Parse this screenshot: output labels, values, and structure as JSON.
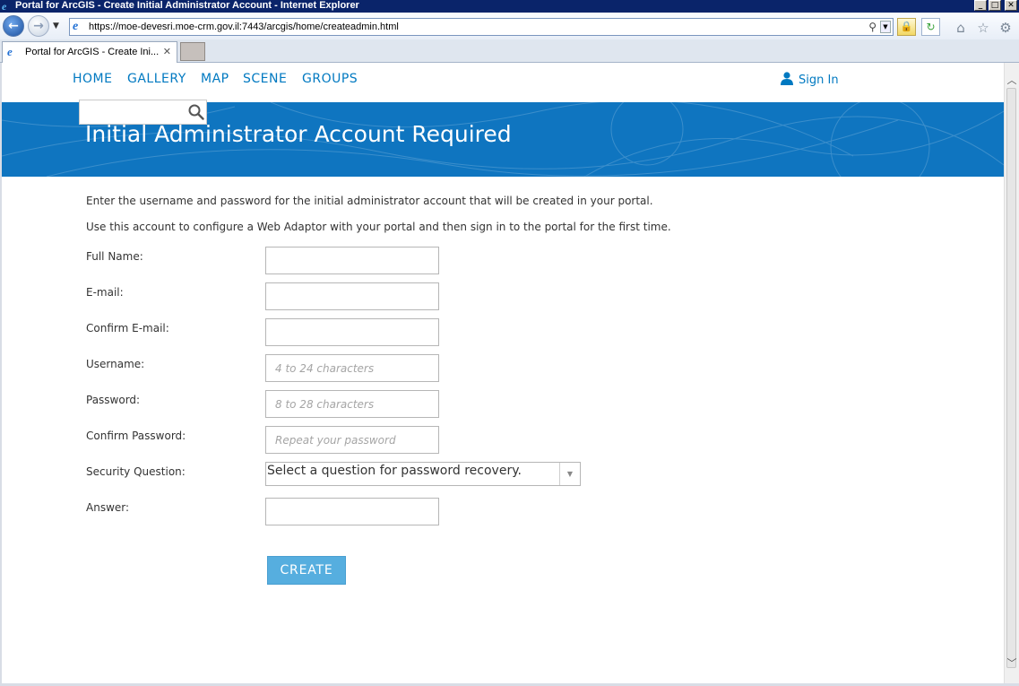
{
  "window": {
    "title": "Portal for ArcGIS - Create Initial Administrator Account - Internet Explorer",
    "minimize": "_",
    "maximize": "□",
    "close": "✕"
  },
  "browser": {
    "url": "https://moe-devesri.moe-crm.gov.il:7443/arcgis/home/createadmin.html",
    "tab_title": "Portal for ArcGIS - Create Ini...",
    "tab_close": "✕",
    "icons": [
      "back-icon",
      "forward-icon",
      "ie-icon",
      "search-icon",
      "lock-icon",
      "refresh-icon",
      "home-icon",
      "favorites-icon",
      "tools-gear-icon"
    ]
  },
  "nav": {
    "home": "HOME",
    "gallery": "GALLERY",
    "map": "MAP",
    "scene": "SCENE",
    "groups": "GROUPS",
    "sign_in": "Sign In"
  },
  "banner": {
    "title": "Initial Administrator Account Required",
    "color": "#0f75c0"
  },
  "intro": {
    "line1": "Enter the username and password for the initial administrator account that will be created in your portal.",
    "line2": "Use this account to configure a Web Adaptor with your portal and then sign in to the portal for the first time."
  },
  "form": {
    "full_name_label": "Full Name:",
    "email_label": "E-mail:",
    "confirm_email_label": "Confirm E-mail:",
    "username_label": "Username:",
    "username_placeholder": "4 to 24 characters",
    "password_label": "Password:",
    "password_placeholder": "8 to 28 characters",
    "confirm_password_label": "Confirm Password:",
    "confirm_password_placeholder": "Repeat your password",
    "security_question_label": "Security Question:",
    "security_question_value": "Select a question for password recovery.",
    "answer_label": "Answer:",
    "create_label": "CREATE"
  },
  "colors": {
    "accent": "#0079c1",
    "button": "#56aedf"
  }
}
